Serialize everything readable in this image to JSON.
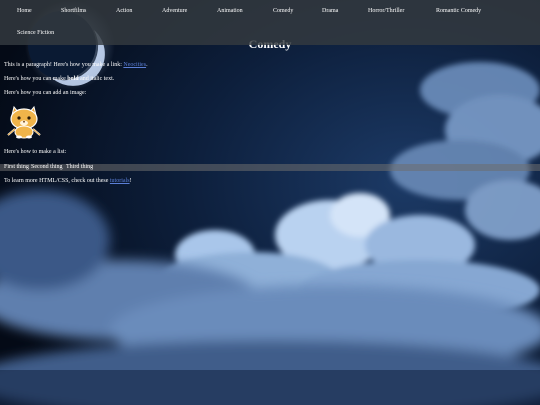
{
  "nav": {
    "items": [
      {
        "label": "Home"
      },
      {
        "label": "Shortfilms"
      },
      {
        "label": "Action"
      },
      {
        "label": "Adventure"
      },
      {
        "label": "Animation"
      },
      {
        "label": "Comedy"
      },
      {
        "label": "Drama"
      },
      {
        "label": "Horror/Thriller"
      },
      {
        "label": "Romantic Comedy"
      },
      {
        "label": "Science Fiction"
      }
    ]
  },
  "main": {
    "title": "Comedy",
    "para_link_prefix": "This is a paragraph! Here's how you make a link: ",
    "para_link_text": "Neocities",
    "para_link_suffix": ".",
    "bold_prefix": "Here's how you can make ",
    "bold_word": "bold",
    "bold_suffix": " and italic text.",
    "image_line": "Here's how you can add an image:",
    "list_intro": "Here's how to make a list:",
    "list_items": [
      "First thing",
      "Second thing",
      "Third thing"
    ],
    "learn_prefix": "To learn more HTML/CSS, check out these ",
    "learn_link": "tutorials",
    "learn_suffix": "!"
  },
  "colors": {
    "navbar": "#343a40",
    "link": "#5b7fd6",
    "sky": "#081426",
    "cloud": "#a9c6ea"
  }
}
